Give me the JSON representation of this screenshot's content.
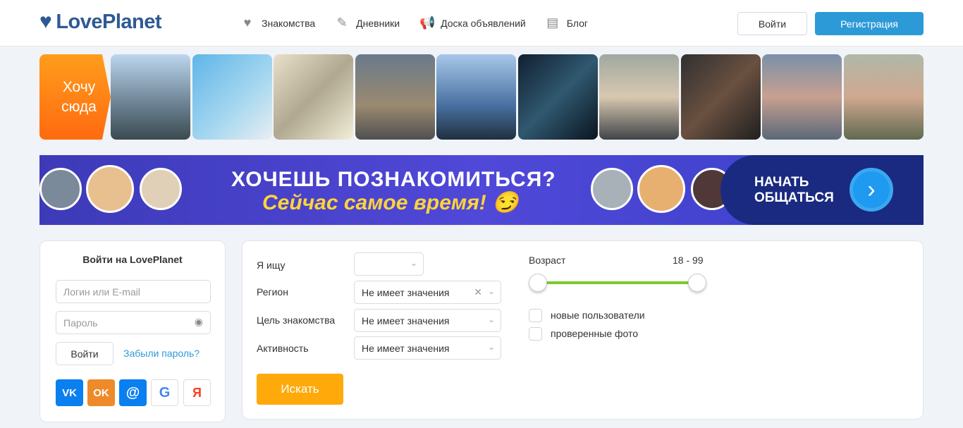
{
  "header": {
    "logo": "LovePlanet",
    "nav": [
      {
        "label": "Знакомства",
        "icon": "heart-icon"
      },
      {
        "label": "Дневники",
        "icon": "pencil-icon"
      },
      {
        "label": "Доска объявлений",
        "icon": "megaphone-icon"
      },
      {
        "label": "Блог",
        "icon": "document-icon"
      }
    ],
    "login": "Войти",
    "register": "Регистрация"
  },
  "strip": {
    "want_here": "Хочу сюда",
    "photo_count": 10
  },
  "banner": {
    "title": "ХОЧЕШЬ ПОЗНАКОМИТЬСЯ?",
    "subtitle": "Сейчас самое время! 😏",
    "cta": "НАЧАТЬ ОБЩАТЬСЯ"
  },
  "login": {
    "title": "Войти на LovePlanet",
    "login_placeholder": "Логин или E-mail",
    "password_placeholder": "Пароль",
    "submit": "Войти",
    "forgot": "Забыли пароль?",
    "social": [
      "VK",
      "OK",
      "@",
      "G",
      "Я"
    ]
  },
  "search": {
    "seeking_label": "Я ищу",
    "seeking_value": "",
    "region_label": "Регион",
    "region_value": "Не имеет значения",
    "goal_label": "Цель знакомства",
    "goal_value": "Не имеет значения",
    "activity_label": "Активность",
    "activity_value": "Не имеет значения",
    "age_label": "Возраст",
    "age_range": "18 - 99",
    "age_min": 18,
    "age_max": 99,
    "new_users": "новые пользователи",
    "verified_photos": "проверенные фото",
    "submit": "Искать"
  },
  "colors": {
    "accent": "#2d9ad8",
    "orange": "#ffa90a",
    "green": "#7acb2a"
  }
}
